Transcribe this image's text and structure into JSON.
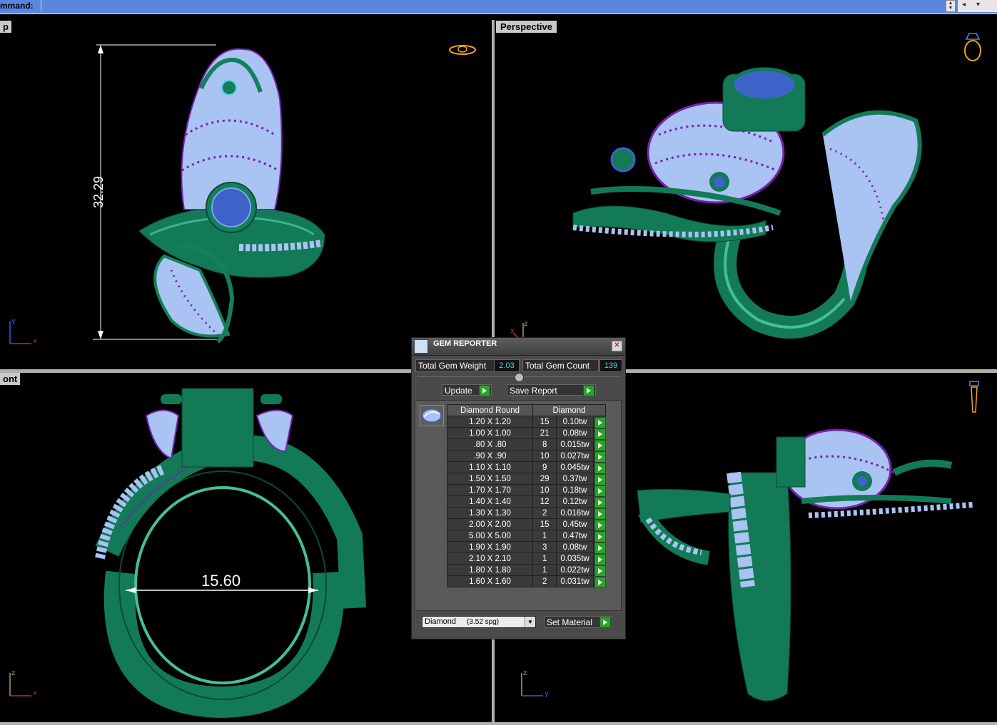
{
  "command_bar": {
    "label": "mmand:",
    "scroll_icon": "scroll-updown-icon",
    "menu_icon": "dropdown-arrow-icon"
  },
  "viewports": {
    "top": {
      "label": "p",
      "dimension": "32.29",
      "axis_y": "y",
      "axis_x": "x"
    },
    "perspective": {
      "label": "Perspective",
      "axis_z": "z",
      "axis_x": "x"
    },
    "front": {
      "label": "ont",
      "dimension": "15.60",
      "axis_z": "z",
      "axis_x": "x"
    },
    "right": {
      "axis_z": "z",
      "axis_y": "y"
    }
  },
  "gem_reporter": {
    "title": "GEM REPORTER",
    "total_weight_label": "Total Gem Weight",
    "total_weight_value": "2.03",
    "total_count_label": "Total Gem Count",
    "total_count_value": "139",
    "update_label": "Update",
    "save_label": "Save Report",
    "table_header_shape": "Diamond Round",
    "table_header_material": "Diamond",
    "rows": [
      {
        "size": "1.20 X 1.20",
        "count": "15",
        "weight": "0.10tw"
      },
      {
        "size": "1.00 X 1.00",
        "count": "21",
        "weight": "0.08tw"
      },
      {
        "size": ".80 X .80",
        "count": "8",
        "weight": "0.015tw"
      },
      {
        "size": ".90 X .90",
        "count": "10",
        "weight": "0.027tw"
      },
      {
        "size": "1.10 X 1.10",
        "count": "9",
        "weight": "0.045tw"
      },
      {
        "size": "1.50 X 1.50",
        "count": "29",
        "weight": "0.37tw"
      },
      {
        "size": "1.70 X 1.70",
        "count": "10",
        "weight": "0.18tw"
      },
      {
        "size": "1.40 X 1.40",
        "count": "12",
        "weight": "0.12tw"
      },
      {
        "size": "1.30 X 1.30",
        "count": "2",
        "weight": "0.016tw"
      },
      {
        "size": "2.00 X 2.00",
        "count": "15",
        "weight": "0.45tw"
      },
      {
        "size": "5.00 X 5.00",
        "count": "1",
        "weight": "0.47tw"
      },
      {
        "size": "1.90 X 1.90",
        "count": "3",
        "weight": "0.08tw"
      },
      {
        "size": "2.10 X 2.10",
        "count": "1",
        "weight": "0.035tw"
      },
      {
        "size": "1.80 X 1.80",
        "count": "1",
        "weight": "0.022tw"
      },
      {
        "size": "1.60 X 1.60",
        "count": "2",
        "weight": "0.031tw"
      }
    ],
    "material_name": "Diamond",
    "material_density": "(3.52 spg)",
    "set_material_label": "Set Material"
  },
  "colors": {
    "background": "#000000",
    "metal": "#14805a",
    "diamond": "#a9c3f2",
    "amethyst_prongs": "#7a1fb0",
    "center_stone": "#3d63c8",
    "command_bar": "#5b86de"
  }
}
